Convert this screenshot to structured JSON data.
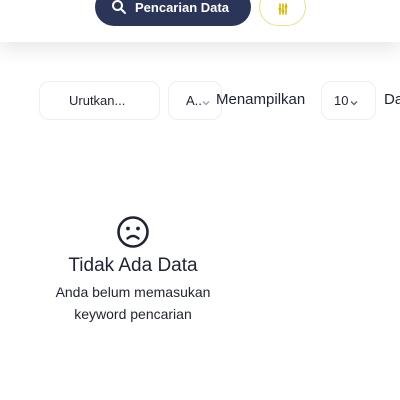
{
  "header": {
    "search_button_label": "Pencarian Data",
    "search_icon": "search-icon",
    "filter_icon": "filter-icon",
    "accent_color": "#2b3558",
    "filter_border_color": "#e9e38a",
    "filter_icon_color": "#d4b800"
  },
  "controls": {
    "sort_select_value": "Urutkan...",
    "order_select_value": "A..",
    "show_label": "Menampilkan",
    "count_select_value": "10",
    "trailing_label": "Da"
  },
  "empty_state": {
    "icon": "sad-face-icon",
    "title": "Tidak Ada Data",
    "message": "Anda belum memasukan keyword pencarian"
  }
}
